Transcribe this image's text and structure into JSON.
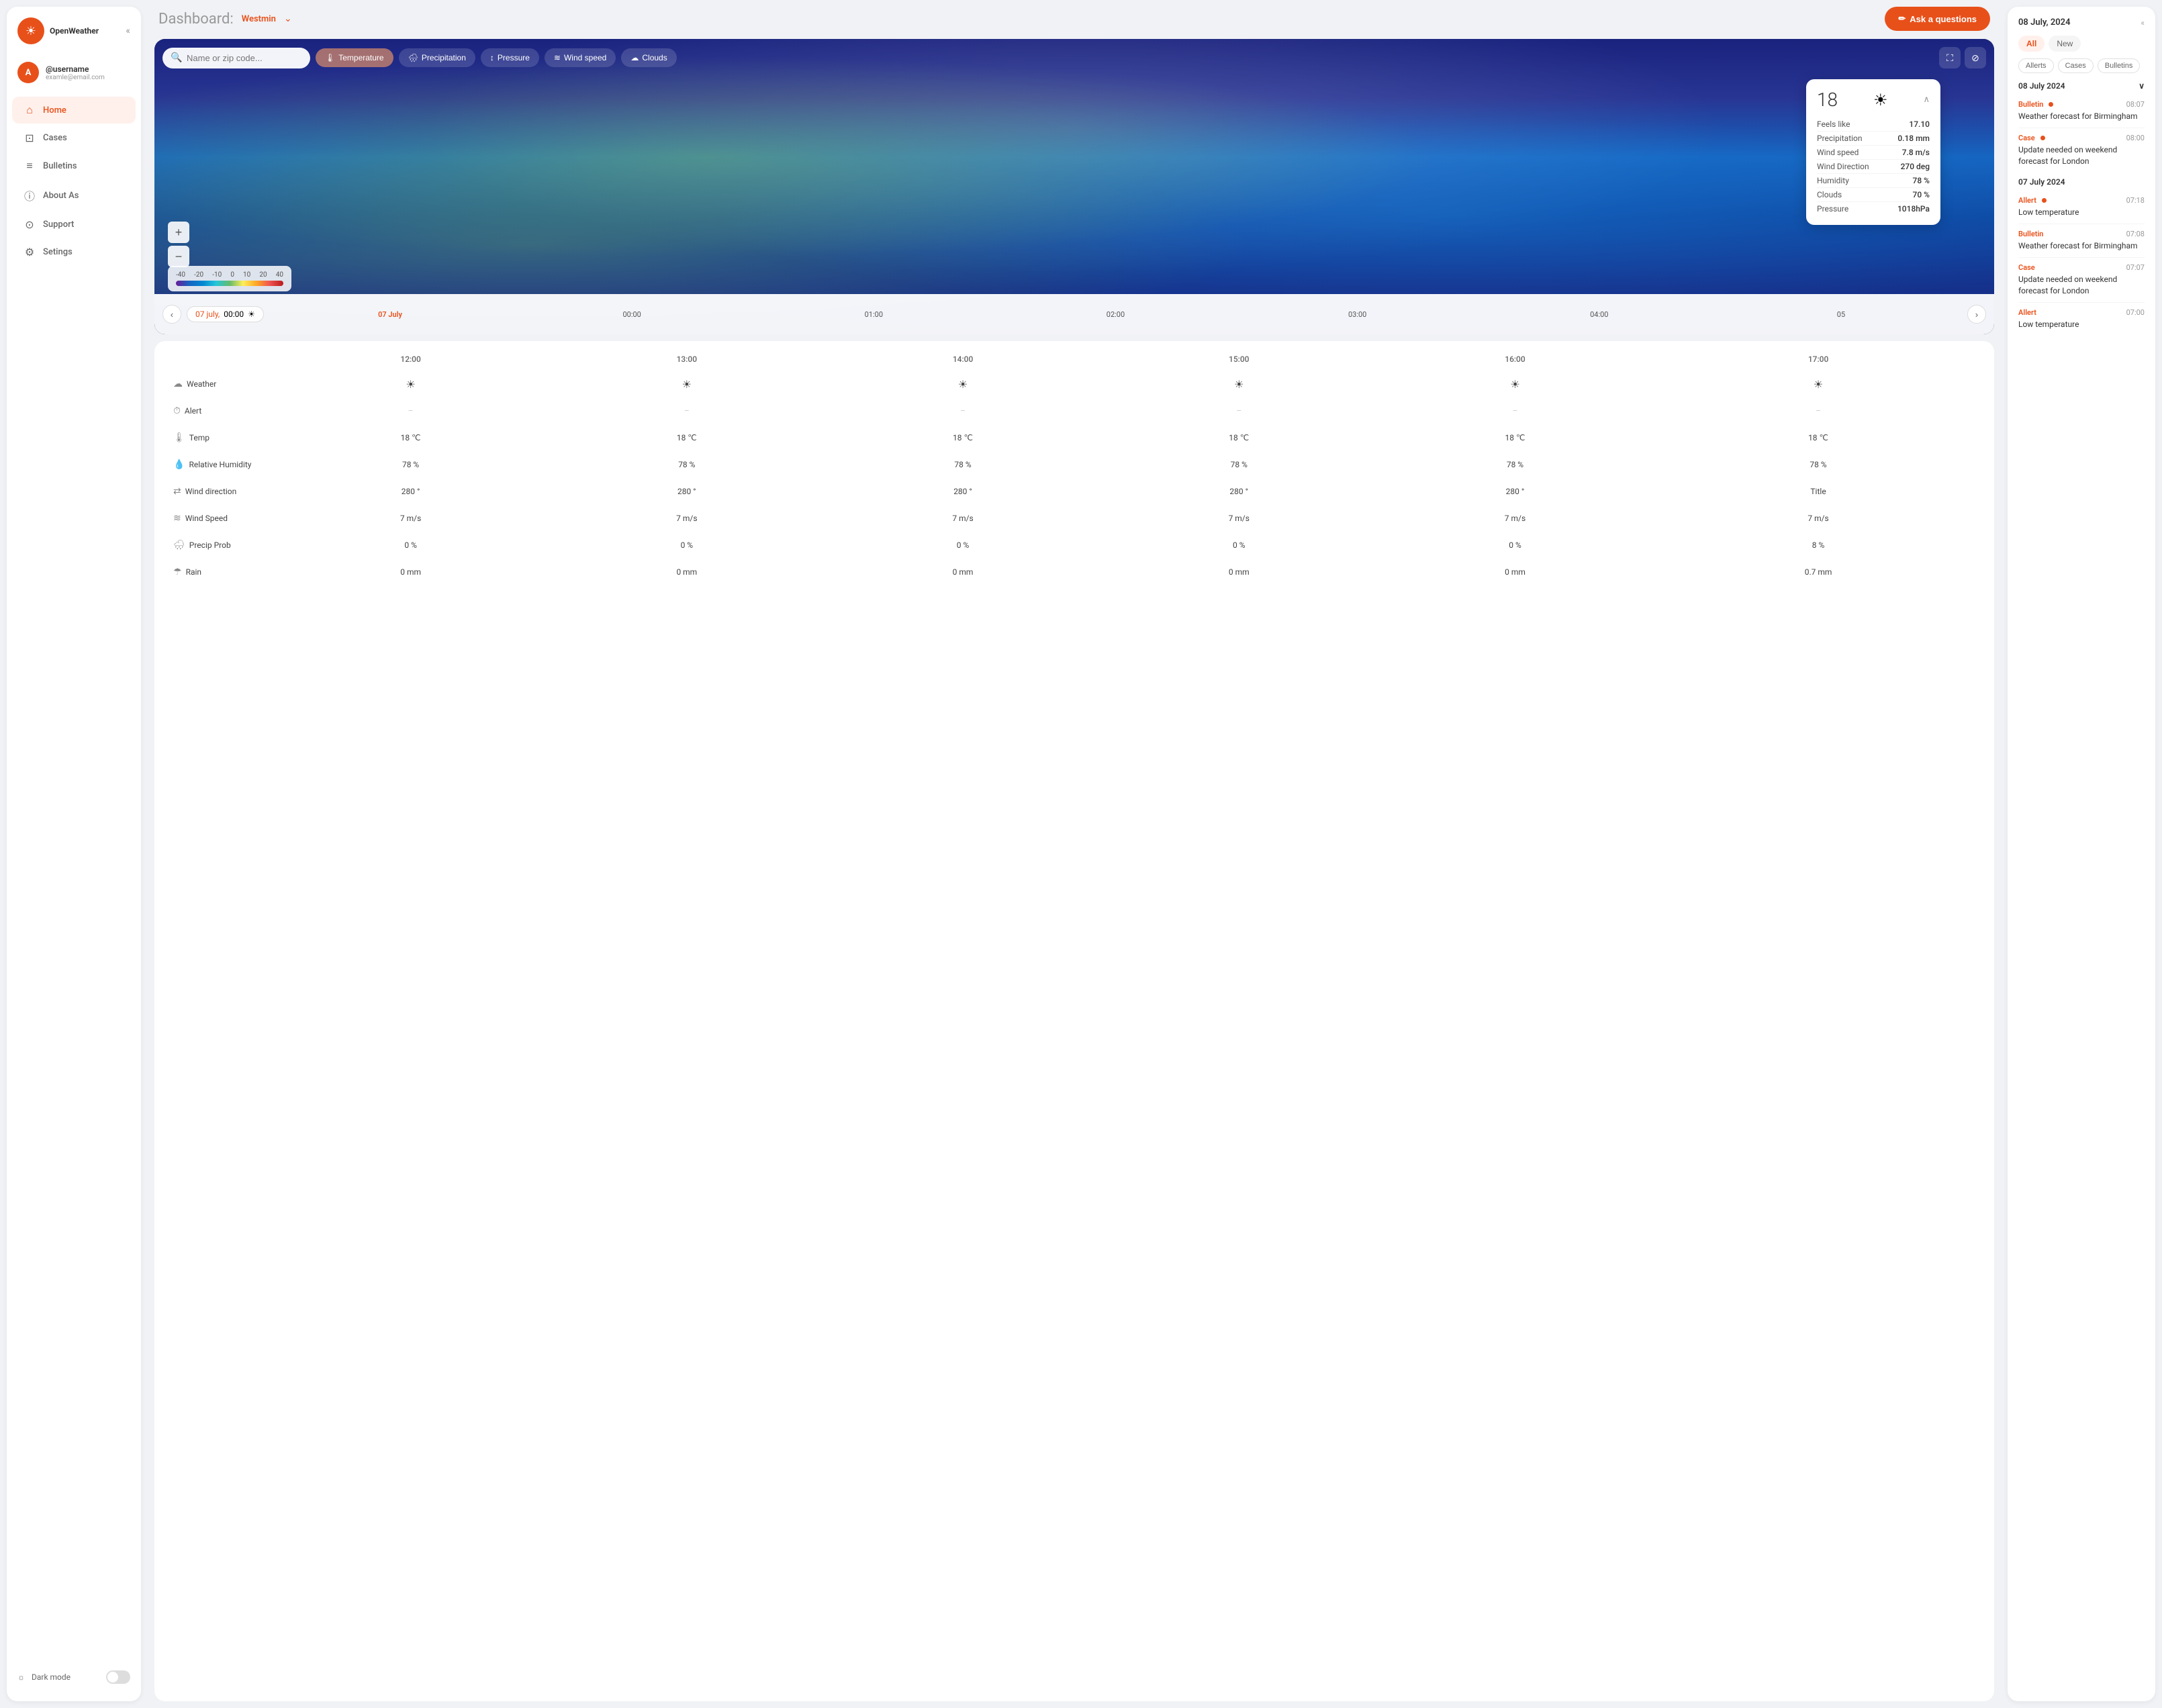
{
  "sidebar": {
    "logo": "☀",
    "logo_name": "OpenWeather",
    "collapse_icon": "«",
    "user": {
      "initial": "A",
      "username": "@username",
      "email": "examle@email.com"
    },
    "nav": [
      {
        "id": "home",
        "label": "Home",
        "icon": "⌂",
        "active": true
      },
      {
        "id": "cases",
        "label": "Cases",
        "icon": "⊡",
        "active": false
      },
      {
        "id": "bulletins",
        "label": "Bulletins",
        "icon": "≡",
        "active": false
      },
      {
        "id": "about",
        "label": "About As",
        "icon": "ⓘ",
        "active": false
      },
      {
        "id": "support",
        "label": "Support",
        "icon": "⊙",
        "active": false
      },
      {
        "id": "settings",
        "label": "Setings",
        "icon": "⚙",
        "active": false
      }
    ],
    "dark_mode_label": "Dark mode"
  },
  "header": {
    "title": "Dashboard:",
    "location": "Westmin",
    "chevron": "∨",
    "ask_btn": "Ask a questions",
    "pencil_icon": "✏"
  },
  "map": {
    "search_placeholder": "Name or zip code...",
    "tabs": [
      {
        "id": "temperature",
        "label": "Temperature",
        "active": true
      },
      {
        "id": "precipitation",
        "label": "Precipitation",
        "active": false
      },
      {
        "id": "pressure",
        "label": "Pressure",
        "active": false
      },
      {
        "id": "wind_speed",
        "label": "Wind speed",
        "active": false
      },
      {
        "id": "clouds",
        "label": "Clouds",
        "active": false
      }
    ],
    "weather_popup": {
      "temp": "18",
      "sun_icon": "☀",
      "rows": [
        {
          "label": "Feels like",
          "value": "17.10"
        },
        {
          "label": "Precipitation",
          "value": "0.18 mm"
        },
        {
          "label": "Wind speed",
          "value": "7.8 m/s"
        },
        {
          "label": "Wind Direction",
          "value": "270 deg"
        },
        {
          "label": "Humidity",
          "value": "78 %"
        },
        {
          "label": "Clouds",
          "value": "70 %"
        },
        {
          "label": "Pressure",
          "value": "1018hPa"
        }
      ]
    },
    "legend": {
      "labels": [
        "-40",
        "-20",
        "-10",
        "0",
        "10",
        "20",
        "40"
      ]
    },
    "timeline": {
      "current_date": "07 july,",
      "current_time": "00:00",
      "current_icon": "☀",
      "ticks": [
        "07 July",
        "00:00",
        "01:00",
        "02:00",
        "03:00",
        "04:00",
        "05"
      ]
    }
  },
  "hourly": {
    "columns": [
      "12:00",
      "13:00",
      "14:00",
      "15:00",
      "16:00",
      "17:00"
    ],
    "rows": [
      {
        "label": "Weather",
        "icon": "☁",
        "values": [
          "☀",
          "☀",
          "☀",
          "☀",
          "☀",
          "☀"
        ]
      },
      {
        "label": "Alert",
        "icon": "⏱",
        "values": [
          "–",
          "–",
          "–",
          "–",
          "–",
          "–"
        ]
      },
      {
        "label": "Temp",
        "icon": "🌡",
        "values": [
          "18 ℃",
          "18 ℃",
          "18 ℃",
          "18 ℃",
          "18 ℃",
          "18 ℃"
        ]
      },
      {
        "label": "Relative Humidity",
        "icon": "💧",
        "values": [
          "78 %",
          "78 %",
          "78 %",
          "78 %",
          "78 %",
          "78 %"
        ]
      },
      {
        "label": "Wind direction",
        "icon": "⇄",
        "values": [
          "280 °",
          "280 °",
          "280 °",
          "280 °",
          "280 °",
          "Title"
        ]
      },
      {
        "label": "Wind Speed",
        "icon": "≈",
        "values": [
          "7 m/s",
          "7 m/s",
          "7 m/s",
          "7 m/s",
          "7 m/s",
          "7 m/s"
        ]
      },
      {
        "label": "Precip Prob",
        "icon": "🌧",
        "values": [
          "0 %",
          "0 %",
          "0 %",
          "0 %",
          "0 %",
          "8 %"
        ]
      },
      {
        "label": "Rain",
        "icon": "☂",
        "values": [
          "0 mm",
          "0 mm",
          "0 mm",
          "0 mm",
          "0 mm",
          "0.7 mm"
        ]
      }
    ]
  },
  "right_panel": {
    "date": "08 July, 2024",
    "collapse_icon": "«",
    "tabs": [
      {
        "label": "All",
        "active": true
      },
      {
        "label": "New",
        "active": false
      }
    ],
    "filter_tabs": [
      {
        "label": "Allerts"
      },
      {
        "label": "Cases"
      },
      {
        "label": "Bulletins"
      }
    ],
    "sections": [
      {
        "date": "08 July 2024",
        "items": [
          {
            "type": "Bulletin",
            "type_key": "bulletin",
            "dot": true,
            "time": "08:07",
            "text": "Weather forecast for Birmingham"
          },
          {
            "type": "Case",
            "type_key": "case",
            "dot": true,
            "time": "08:00",
            "text": "Update needed on weekend forecast for London"
          }
        ]
      },
      {
        "date": "07 July 2024",
        "items": [
          {
            "type": "Allert",
            "type_key": "allert",
            "dot": true,
            "time": "07:18",
            "text": "Low temperature"
          },
          {
            "type": "Bulletin",
            "type_key": "bulletin",
            "dot": false,
            "time": "07:08",
            "text": "Weather forecast for Birmingham"
          },
          {
            "type": "Case",
            "type_key": "case",
            "dot": false,
            "time": "07:07",
            "text": "Update needed on weekend forecast for London"
          },
          {
            "type": "Allert",
            "type_key": "allert",
            "dot": false,
            "time": "07:00",
            "text": "Low temperature"
          }
        ]
      }
    ]
  }
}
